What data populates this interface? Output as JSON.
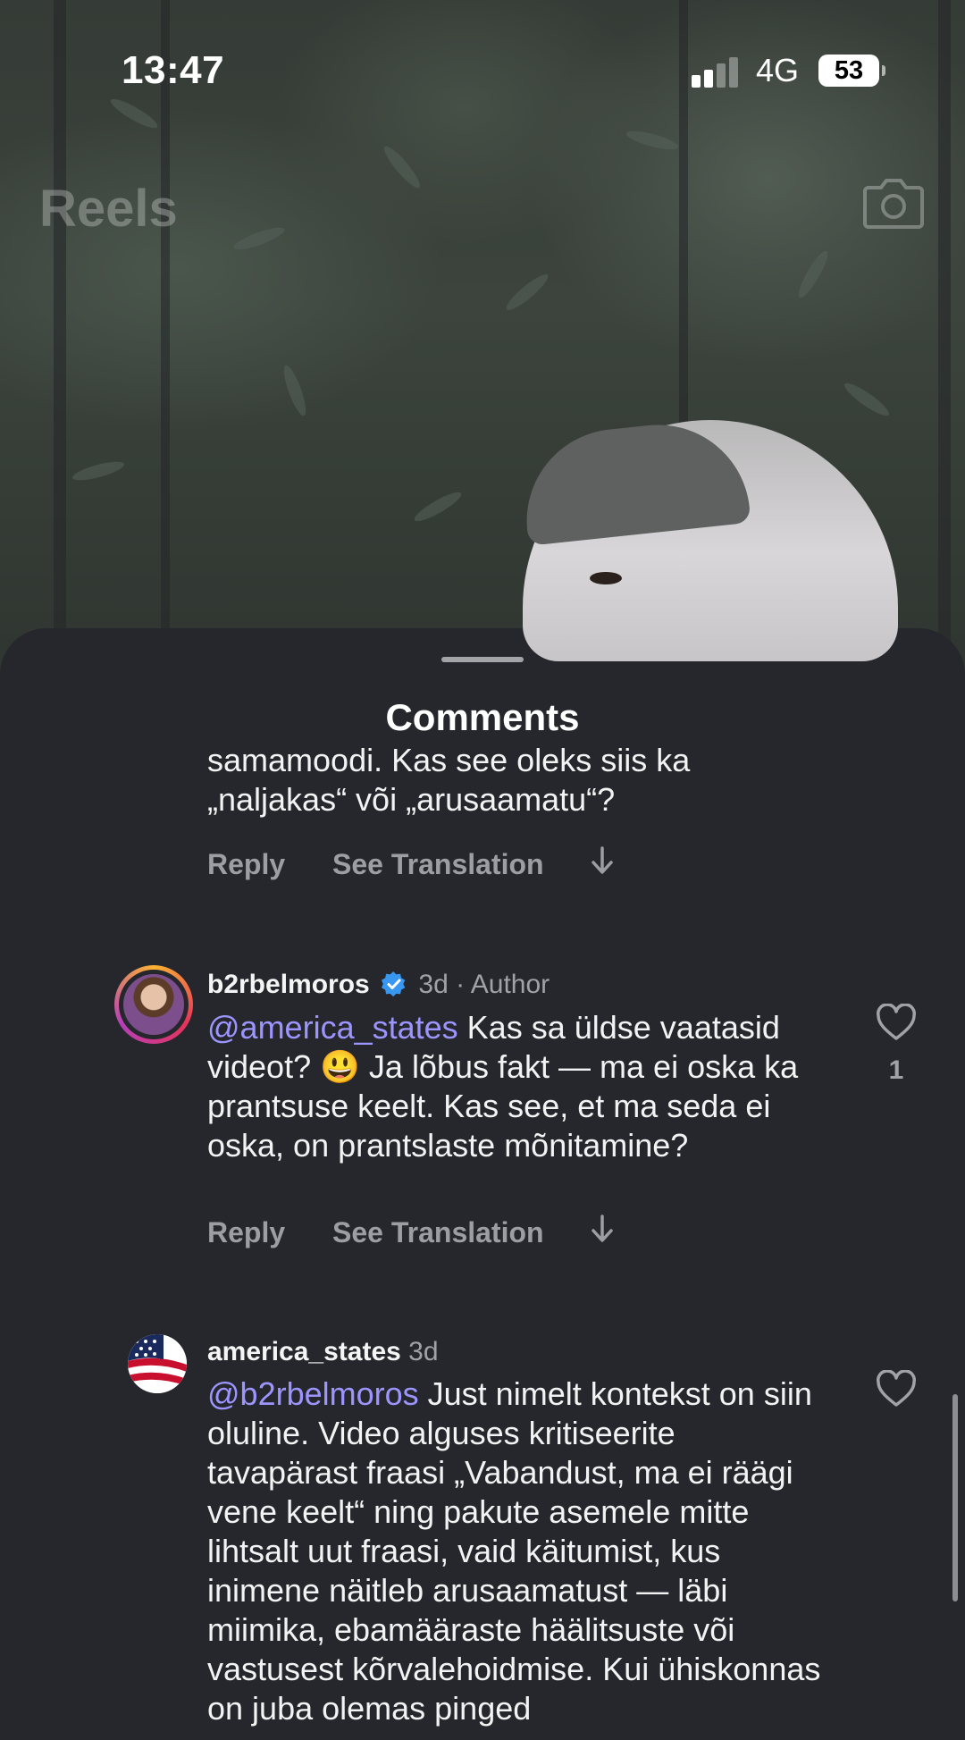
{
  "status_bar": {
    "time": "13:47",
    "network": "4G",
    "battery": "53"
  },
  "header": {
    "title": "Reels",
    "camera_icon": "camera-icon"
  },
  "comments_sheet": {
    "title": "Comments",
    "colors": {
      "sheet_bg": "#25272c",
      "mention": "#9d95ff",
      "meta": "#a0a2a7"
    },
    "comments": [
      {
        "text_line1": "samamoodi. Kas see oleks siis ka",
        "text_line2": "„naljakas“ või „arusaamatu“?",
        "reply_label": "Reply",
        "translation_label": "See Translation"
      },
      {
        "username": "b2rbelmoros",
        "verified": true,
        "meta": "3d · Author",
        "mention": "@america_states",
        "text": "Kas sa üldse vaatasid videot? 😃 Ja lõbus fakt — ma ei oska ka prantsuse keelt. Kas see, et ma seda ei oska, on prantslaste mõnitamine?",
        "likes": "1",
        "reply_label": "Reply",
        "translation_label": "See Translation"
      },
      {
        "username": "america_states",
        "meta": "3d",
        "mention": "@b2rbelmoros",
        "text": "Just nimelt kontekst on siin oluline. Video alguses kritiseerite tavapärast fraasi „Vabandust, ma ei räägi vene keelt“ ning pakute asemele mitte lihtsalt uut fraasi, vaid käitumist, kus inimene näitleb arusaamatust — läbi miimika, ebamääraste häälitsuste või vastusest kõrvalehoidmise. Kui ühiskonnas on juba olemas pinged"
      }
    ]
  }
}
